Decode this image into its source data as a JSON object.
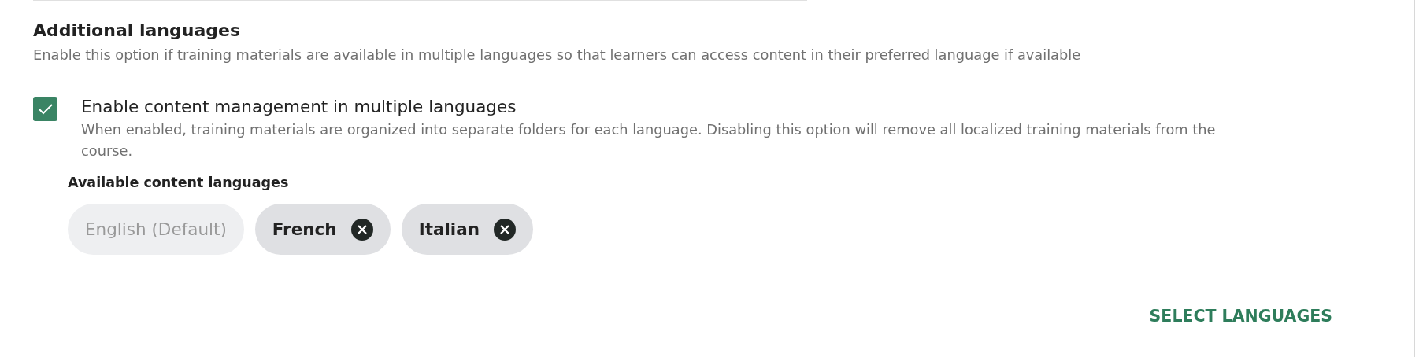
{
  "section": {
    "title": "Additional languages",
    "description": "Enable this option if training materials are available in multiple languages so that learners can access content in their preferred language if available"
  },
  "option": {
    "label": "Enable content management in multiple languages",
    "checked": true,
    "help": "When enabled, training materials are organized into separate folders for each language. Disabling this option will remove all localized training materials from the course."
  },
  "languages": {
    "label": "Available content languages",
    "chips": [
      {
        "label": "English (Default)",
        "removable": false
      },
      {
        "label": "French",
        "removable": true
      },
      {
        "label": "Italian",
        "removable": true
      }
    ]
  },
  "action_button": "SELECT LANGUAGES"
}
